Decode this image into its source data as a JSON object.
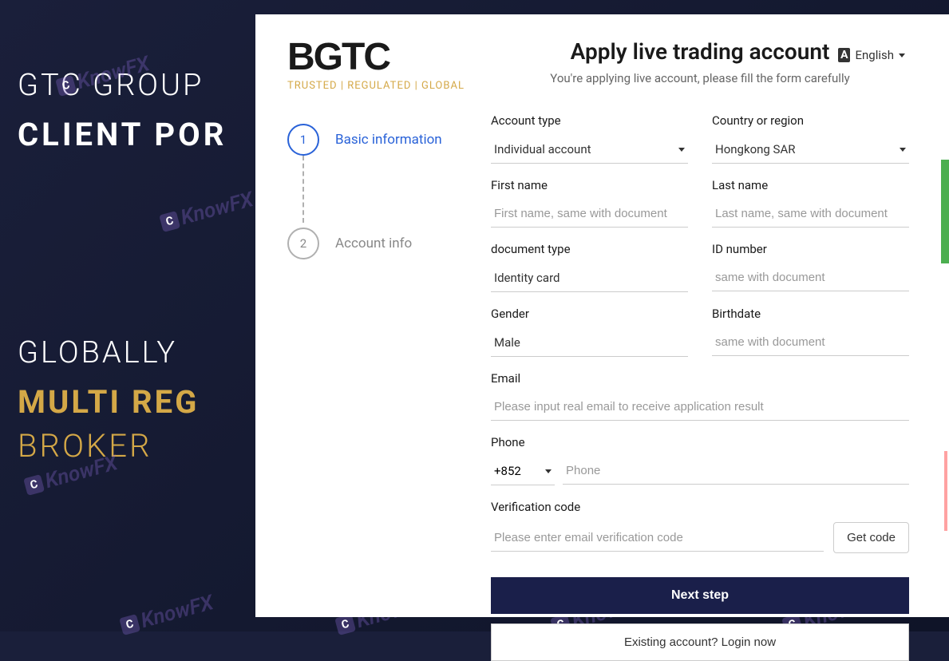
{
  "background": {
    "line1": "GTC GROUP",
    "line2": "CLIENT POR",
    "line3": "GLOBALLY",
    "line4": "MULTI REG",
    "line5": "BROKER"
  },
  "watermark": "KnowFX",
  "logo": {
    "main": "BGTC",
    "tagline": "TRUSTED | REGULATED | GLOBAL"
  },
  "lang": {
    "label": "English",
    "icon_text": "A⁄B"
  },
  "steps": {
    "s1": {
      "num": "1",
      "label": "Basic information"
    },
    "s2": {
      "num": "2",
      "label": "Account info"
    }
  },
  "form": {
    "title": "Apply live trading account",
    "subtitle": "You're applying live account, please fill the form carefully",
    "account_type": {
      "label": "Account type",
      "value": "Individual account"
    },
    "country": {
      "label": "Country or region",
      "value": "Hongkong SAR"
    },
    "first_name": {
      "label": "First name",
      "placeholder": "First name, same with document"
    },
    "last_name": {
      "label": "Last name",
      "placeholder": "Last name, same with document"
    },
    "doc_type": {
      "label": "document type",
      "value": "Identity card"
    },
    "id_number": {
      "label": "ID number",
      "placeholder": "same with document"
    },
    "gender": {
      "label": "Gender",
      "value": "Male"
    },
    "birthdate": {
      "label": "Birthdate",
      "placeholder": "same with document"
    },
    "email": {
      "label": "Email",
      "placeholder": "Please input real email to receive application result"
    },
    "phone": {
      "label": "Phone",
      "prefix": "+852",
      "placeholder": "Phone"
    },
    "code": {
      "label": "Verification code",
      "placeholder": "Please enter email verification code",
      "button": "Get code"
    },
    "next_btn": "Next step",
    "login_btn": "Existing account? Login now"
  }
}
